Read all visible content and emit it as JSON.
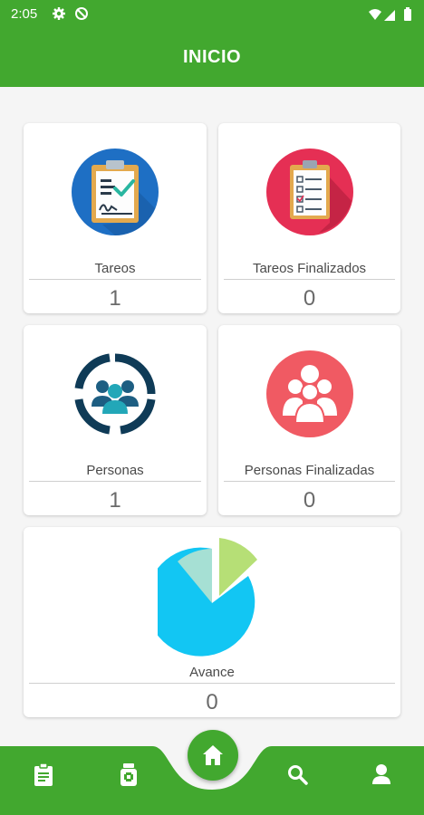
{
  "status_bar": {
    "time": "2:05"
  },
  "app_bar": {
    "title": "INICIO"
  },
  "cards": {
    "tareos": {
      "label": "Tareos",
      "value": "1",
      "icon": "clipboard-check-icon"
    },
    "tareos_finalizados": {
      "label": "Tareos Finalizados",
      "value": "0",
      "icon": "checklist-clipboard-icon"
    },
    "personas": {
      "label": "Personas",
      "value": "1",
      "icon": "people-group-icon"
    },
    "personas_finalizadas": {
      "label": "Personas Finalizadas",
      "value": "0",
      "icon": "people-group-icon"
    },
    "avance": {
      "label": "Avance",
      "value": "0",
      "icon": "pie-chart-icon"
    }
  },
  "bottom_nav": {
    "items": [
      "clipboard-icon",
      "medicine-bottle-icon",
      "home-icon",
      "search-icon",
      "user-icon"
    ]
  },
  "colors": {
    "primary": "#42a82f",
    "tareos_circle": "#1e6fc4",
    "tareos_fin_circle": "#e52f54",
    "personas_ring": "#0f3b57",
    "personas_fin_circle": "#f05a63",
    "pie_main": "#12c6f3",
    "pie_slice_green": "#b6df76",
    "pie_slice_mint": "#a6e0d4"
  }
}
